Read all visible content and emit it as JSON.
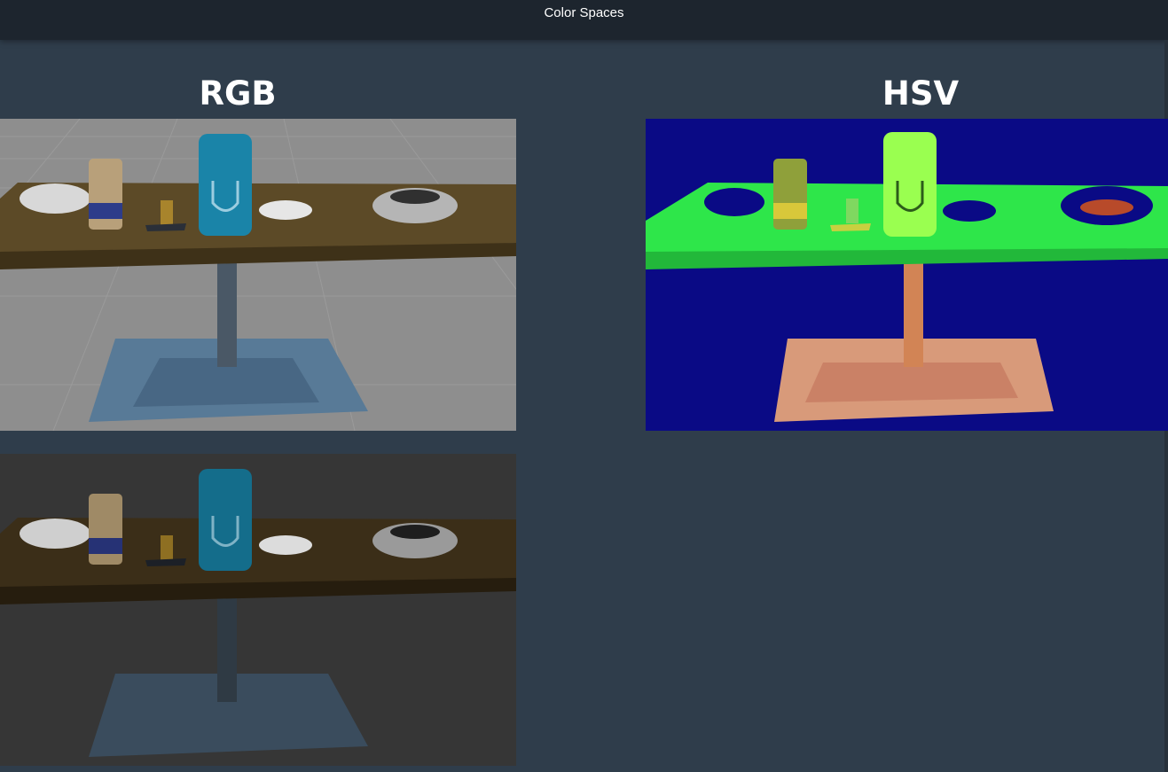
{
  "window": {
    "title": "Color Spaces"
  },
  "slide": {
    "left_heading": "RGB",
    "right_heading": "HSV"
  },
  "images": [
    {
      "name": "rgb-scene-bright",
      "description_icon": "table-scene-image"
    },
    {
      "name": "rgb-scene-dark",
      "description_icon": "table-scene-image"
    },
    {
      "name": "hsv-scene",
      "description_icon": "table-scene-image"
    }
  ],
  "colors": {
    "background": "#2f3d4b",
    "titlebar": "#1d252e",
    "hsv_background": "#0a0a85",
    "hsv_table": "#2ee64a",
    "can_blue": "#1a84a8"
  }
}
